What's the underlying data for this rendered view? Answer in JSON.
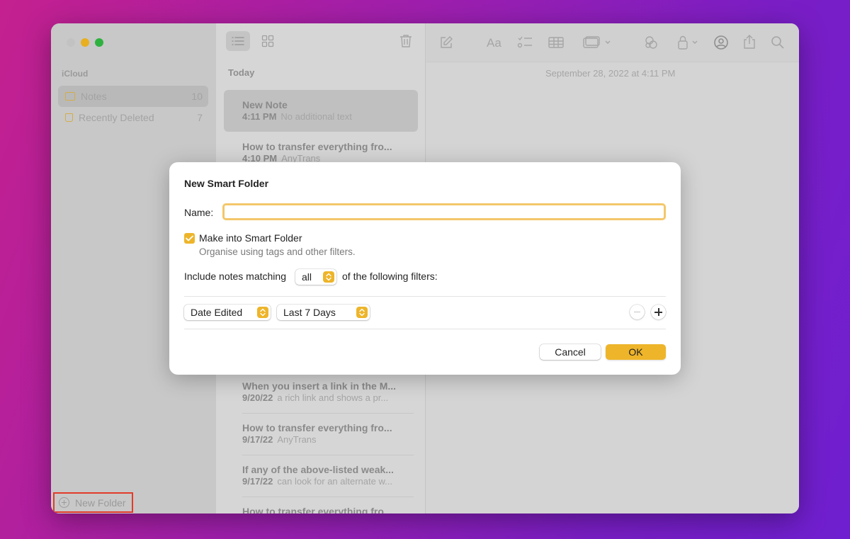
{
  "sidebar": {
    "section": "iCloud",
    "items": [
      {
        "label": "Notes",
        "count": "10"
      },
      {
        "label": "Recently Deleted",
        "count": "7"
      }
    ],
    "new_folder": "New Folder"
  },
  "list": {
    "header": "Today",
    "notes": [
      {
        "title": "New Note",
        "time": "4:11 PM",
        "preview": "No additional text"
      },
      {
        "title": "How to transfer everything fro...",
        "time": "4:10 PM",
        "preview": "AnyTrans"
      },
      {
        "title": "When you insert a link in the M...",
        "time": "9/20/22",
        "preview": "a rich link and shows a pr..."
      },
      {
        "title": "How to transfer everything fro...",
        "time": "9/17/22",
        "preview": "AnyTrans"
      },
      {
        "title": "If any of the above-listed weak...",
        "time": "9/17/22",
        "preview": "can look for an alternate w..."
      },
      {
        "title": "How to transfer everything fro...",
        "time": "",
        "preview": ""
      }
    ]
  },
  "editor": {
    "date": "September 28, 2022 at 4:11 PM"
  },
  "toolbar_icons": [
    "list-view-icon",
    "gallery-view-icon",
    "trash-icon",
    "compose-icon",
    "format-icon",
    "checklist-icon",
    "table-icon",
    "media-icon",
    "collaborate-icon",
    "lock-icon",
    "share-people-icon",
    "share-icon",
    "search-icon"
  ],
  "dialog": {
    "title": "New Smart Folder",
    "name_label": "Name:",
    "name_value": "",
    "checkbox_label": "Make into Smart Folder",
    "checkbox_sub": "Organise using tags and other filters.",
    "include_prefix": "Include notes matching",
    "match_value": "all",
    "include_suffix": "of the following filters:",
    "filter_field": "Date Edited",
    "filter_value": "Last 7 Days",
    "cancel": "Cancel",
    "ok": "OK"
  },
  "colors": {
    "accent": "#eeb52a",
    "focus_ring": "#f3c76a",
    "highlight_box": "#e23b2a"
  }
}
